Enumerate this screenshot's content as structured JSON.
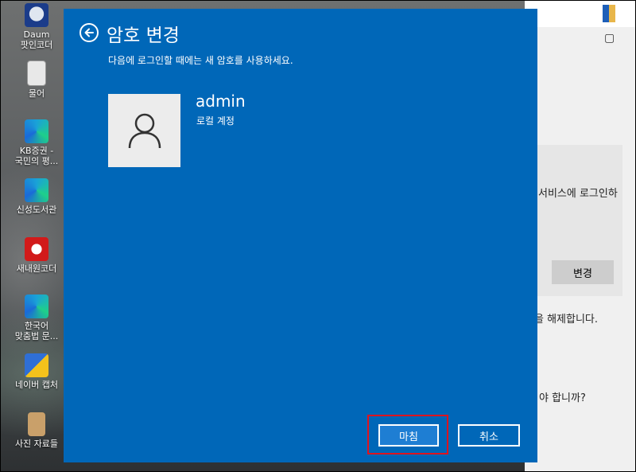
{
  "desktop": {
    "icons": [
      {
        "label": "Daum\n팟인코더",
        "icon": "daum-potencoder-icon"
      },
      {
        "label": "물어",
        "icon": "document-icon"
      },
      {
        "label": "KB증권 -\n국민의 평...",
        "icon": "edge-shortcut-icon"
      },
      {
        "label": "신성도서관",
        "icon": "edge-shortcut-icon"
      },
      {
        "label": "새내원코더",
        "icon": "red-app-icon"
      },
      {
        "label": "한국어\n맞춤법 문...",
        "icon": "edge-shortcut-icon"
      },
      {
        "label": "네이버 캡처",
        "icon": "capture-app-icon"
      },
      {
        "label": "사진 자료들",
        "icon": "folder-icon"
      }
    ]
  },
  "background_window": {
    "text_service_login": "서비스에 로그인하",
    "change_button": "변경",
    "text_release": "을 해제합니다.",
    "text_question": "야 합니까?"
  },
  "dialog": {
    "title": "암호 변경",
    "subtitle": "다음에 로그인할 때에는 새 암호를 사용하세요.",
    "username": "admin",
    "account_type": "로컬 계정",
    "finish_button": "마침",
    "cancel_button": "취소",
    "colors": {
      "background": "#0067b8",
      "highlight_border": "#e0141e"
    }
  }
}
